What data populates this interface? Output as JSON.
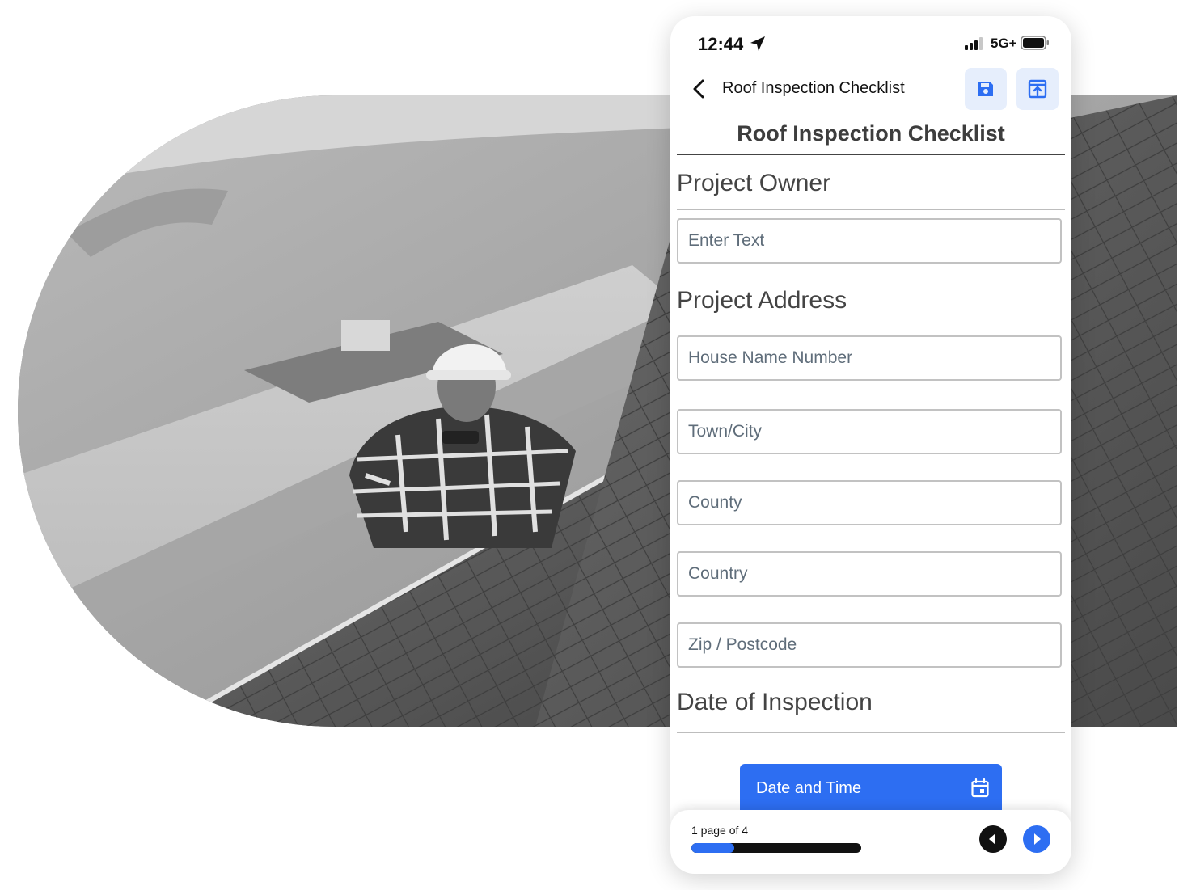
{
  "status_bar": {
    "time": "12:44",
    "network": "5G+"
  },
  "app_bar": {
    "title": "Roof Inspection Checklist"
  },
  "form": {
    "title": "Roof Inspection Checklist",
    "sections": {
      "owner": "Project Owner",
      "address": "Project Address",
      "date": "Date of Inspection"
    },
    "fields": {
      "owner_placeholder": "Enter Text",
      "house_placeholder": "House Name Number",
      "town_placeholder": "Town/City",
      "county_placeholder": "County",
      "country_placeholder": "Country",
      "zip_placeholder": "Zip / Postcode"
    },
    "date_button_label": "Date and Time"
  },
  "pager": {
    "label": "1 page of 4",
    "progress_fraction": 0.25
  },
  "colors": {
    "accent": "#2d6ef2",
    "accent_light": "#e6eefc"
  },
  "icons": {
    "location": "location-arrow-icon",
    "signal": "signal-bars-icon",
    "battery": "battery-icon",
    "back": "chevron-left-icon",
    "save": "floppy-disk-icon",
    "export": "export-icon",
    "calendar": "calendar-icon",
    "prev": "circle-arrow-left-icon",
    "next": "circle-arrow-right-icon"
  }
}
